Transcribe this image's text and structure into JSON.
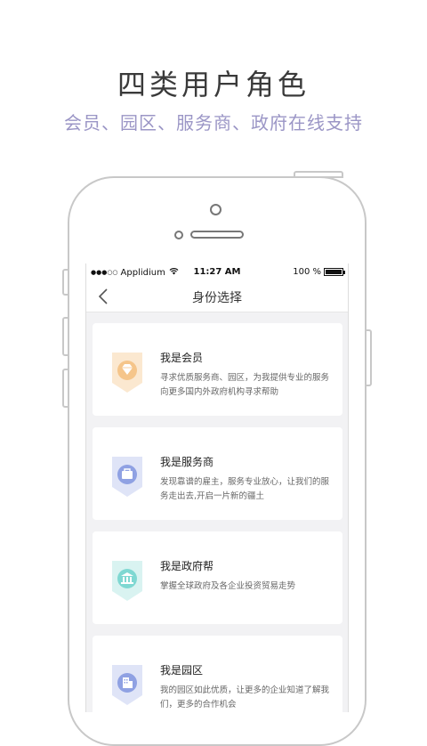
{
  "promo": {
    "headline": "四类用户角色",
    "subheadline": "会员、园区、服务商、政府在线支持"
  },
  "statusbar": {
    "carrier": "Applidium",
    "time": "11:27 AM",
    "battery": "100 %"
  },
  "navbar": {
    "title": "身份选择"
  },
  "roles": [
    {
      "title": "我是会员",
      "desc": "寻求优质服务商、园区，为我提供专业的服务向更多国内外政府机构寻求帮助",
      "icon": "diamond-icon",
      "color": "#f5c58a"
    },
    {
      "title": "我是服务商",
      "desc": "发现靠谱的雇主，服务专业放心，让我们的服务走出去,开启一片新的疆土",
      "icon": "briefcase-icon",
      "color": "#8fa1e3"
    },
    {
      "title": "我是政府帮",
      "desc": "掌握全球政府及各企业投资贸易走势",
      "icon": "government-building-icon",
      "color": "#7fd8d2"
    },
    {
      "title": "我是园区",
      "desc": "我的园区如此优质，让更多的企业知道了解我们，更多的合作机会",
      "icon": "office-building-icon",
      "color": "#8fa1e3"
    }
  ]
}
